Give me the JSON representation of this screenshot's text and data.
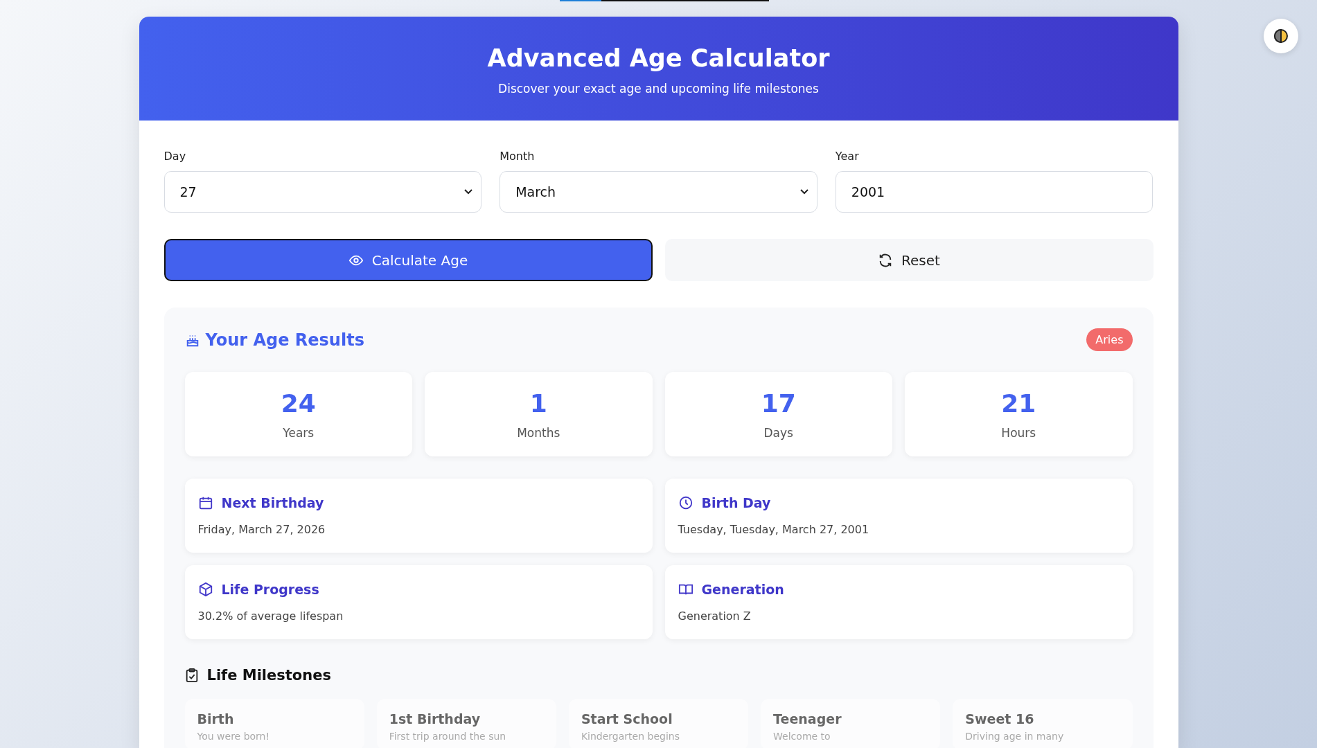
{
  "top_progress": {
    "level": 0.2
  },
  "theme_toggle": {
    "kind": "moon"
  },
  "header": {
    "title": "Advanced Age Calculator",
    "subtitle": "Discover your exact age and upcoming life milestones"
  },
  "form": {
    "fields": [
      {
        "label": "Day",
        "kind": "select",
        "value": "27"
      },
      {
        "label": "Month",
        "kind": "select",
        "value": "March"
      },
      {
        "label": "Year",
        "kind": "input",
        "value": "2001"
      }
    ],
    "buttons": [
      {
        "label": "Calculate Age",
        "kind": "primary"
      },
      {
        "label": "Reset",
        "kind": "secondary"
      }
    ]
  },
  "results": {
    "title": "Your Age Results",
    "zodiac": "Aries",
    "stats": [
      {
        "value": "24",
        "label": "Years"
      },
      {
        "value": "1",
        "label": "Months"
      },
      {
        "value": "17",
        "label": "Days"
      },
      {
        "value": "21",
        "label": "Hours"
      }
    ],
    "info": [
      {
        "title": "Next Birthday",
        "text": "Friday, March 27, 2026"
      },
      {
        "title": "Birth Day",
        "text": "Tuesday, Tuesday, March 27, 2001"
      },
      {
        "title": "Life Progress",
        "text": "30.2% of average lifespan"
      },
      {
        "title": "Generation",
        "text": "Generation Z"
      }
    ],
    "milestones_title": "Life Milestones",
    "milestones": [
      {
        "title": "Birth",
        "text": "You were born!"
      },
      {
        "title": "1st Birthday",
        "text": "First trip around the sun"
      },
      {
        "title": "Start School",
        "text": "Kindergarten begins"
      },
      {
        "title": "Teenager",
        "text": "Welcome to"
      },
      {
        "title": "Sweet 16",
        "text": "Driving age in many"
      }
    ]
  }
}
